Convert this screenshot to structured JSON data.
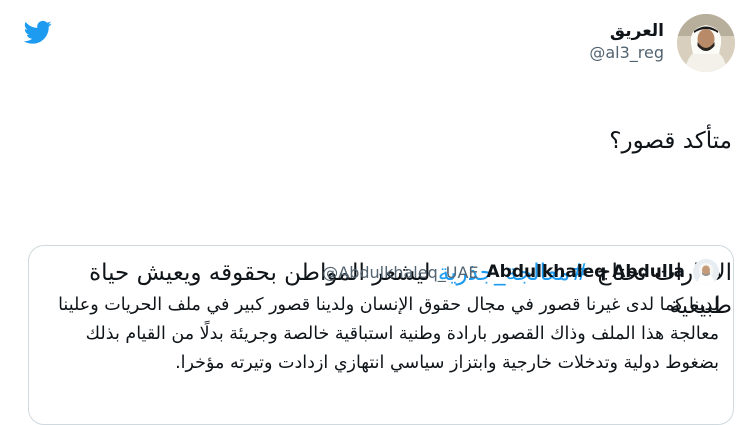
{
  "tweet": {
    "author_name": "العريق",
    "author_handle": "@al3_reg",
    "text_line1": "متأكد قصور؟",
    "text_before_hashtag": "الامارات تحتاج ",
    "hashtag": "#معالجة_جذرية",
    "text_after_hashtag": " ليشعر المواطن بحقوقه ويعيش حياة طبيعية"
  },
  "quoted": {
    "author_name": "Abdulkhaleq Abdulla",
    "author_handle": "@Abdulkhaleq_UAE",
    "text": "لدينا كما لدى غيرنا قصور في مجال حقوق الإنسان ولدينا قصور كبير في ملف الحريات وعلينا معالجة هذا الملف وذاك القصور بارادة وطنية استباقية خالصة وجريئة بدلًا من القيام بذلك بضغوط دولية وتدخلات خارجية وابتزاز سياسي انتهازي ازدادت وتيرته مؤخرا."
  },
  "colors": {
    "brand": "#1d9bf0",
    "text": "#0f1419",
    "muted": "#536471",
    "border": "#cfd9de"
  },
  "icons": {
    "logo": "twitter-bird-icon"
  }
}
